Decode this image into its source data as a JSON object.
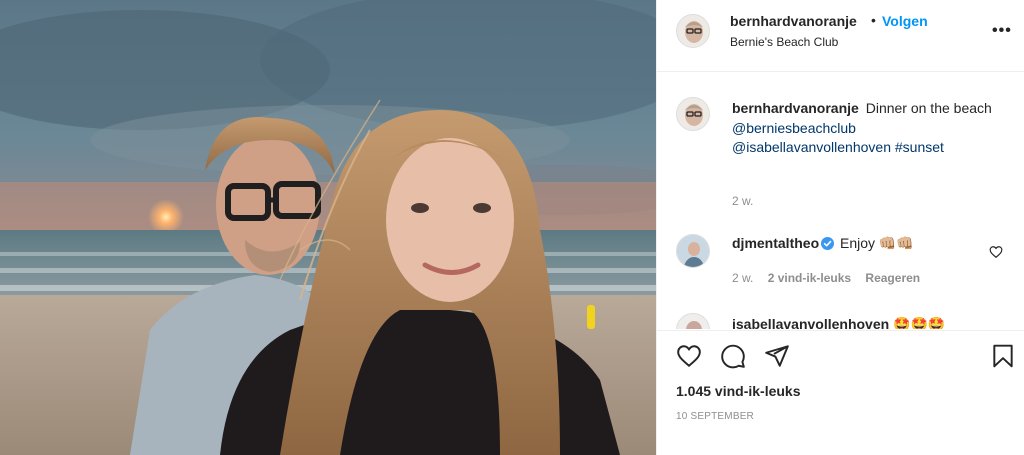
{
  "post": {
    "username": "bernhardvanoranje",
    "separator": "•",
    "follow_label": "Volgen",
    "location": "Bernie's Beach Club",
    "more_label": "•••",
    "photo_icon": "photo",
    "caption": {
      "username": "bernhardvanoranje",
      "text": "Dinner on the beach",
      "mention_1": "@berniesbeachclub",
      "mention_2": "@isabellavanvollenhoven",
      "hashtag": "#sunset",
      "timestamp": "2 w."
    },
    "comments": [
      {
        "username": "djmentaltheo",
        "verified": true,
        "text": "Enjoy 👊🏼👊🏼",
        "timestamp": "2 w.",
        "likes": "2 vind-ik-leuks",
        "reply_label": "Reageren"
      },
      {
        "username": "isabellavanvollenhoven",
        "text": "🤩🤩🤩"
      }
    ],
    "likes_count": "1.045 vind-ik-leuks",
    "date": "10 SEPTEMBER"
  },
  "icons": {
    "like": "heart-icon",
    "comment": "comment-icon",
    "share": "paper-plane-icon",
    "save": "bookmark-icon",
    "verified": "verified-badge-icon",
    "comment_like": "heart-icon"
  },
  "colors": {
    "accent": "#0095f6",
    "link": "#00376b",
    "muted": "#8e8e8e",
    "text": "#262626",
    "border": "#efefef"
  }
}
